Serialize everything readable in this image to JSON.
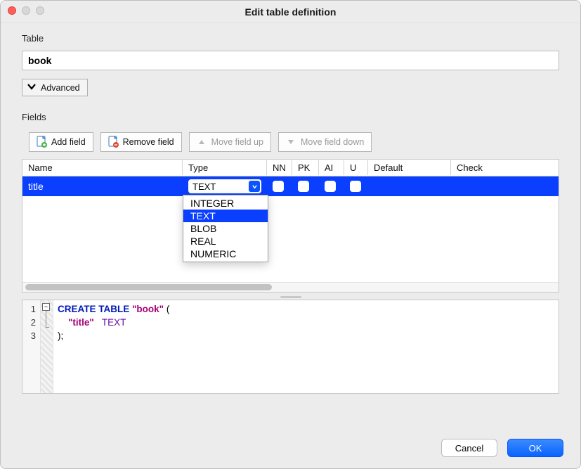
{
  "window": {
    "title": "Edit table definition"
  },
  "sections": {
    "table_label": "Table",
    "fields_label": "Fields"
  },
  "table_name": "book",
  "advanced_button": "Advanced",
  "toolbar": {
    "add_field": "Add field",
    "remove_field": "Remove field",
    "move_up": "Move field up",
    "move_down": "Move field down"
  },
  "columns": {
    "name": "Name",
    "type": "Type",
    "nn": "NN",
    "pk": "PK",
    "ai": "AI",
    "u": "U",
    "default": "Default",
    "check": "Check"
  },
  "rows": [
    {
      "name": "title",
      "type": "TEXT",
      "nn": false,
      "pk": false,
      "ai": false,
      "u": false,
      "default": "",
      "check": ""
    }
  ],
  "type_dropdown": {
    "selected": "TEXT",
    "options": [
      "INTEGER",
      "TEXT",
      "BLOB",
      "REAL",
      "NUMERIC"
    ]
  },
  "sql": {
    "line_numbers": [
      "1",
      "2",
      "3"
    ],
    "tokens": {
      "create": "CREATE TABLE",
      "tname": "\"book\"",
      "open": " (",
      "field": "\"title\"",
      "ftype": "TEXT",
      "close": ");"
    }
  },
  "buttons": {
    "cancel": "Cancel",
    "ok": "OK"
  }
}
